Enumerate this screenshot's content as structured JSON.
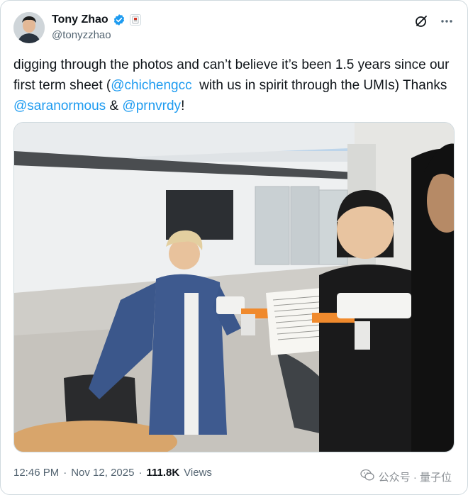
{
  "author": {
    "name": "Tony Zhao",
    "handle": "@tonyzzhao"
  },
  "post": {
    "text_segments": [
      {
        "text": "digging through the photos and can’t believe it’s been 1.5 years since our first term sheet (",
        "type": "text"
      },
      {
        "text": "@chichengcc",
        "type": "mention"
      },
      {
        "text": "  with us in spirit through the UMIs) Thanks ",
        "type": "text"
      },
      {
        "text": "@saranormous",
        "type": "mention"
      },
      {
        "text": " & ",
        "type": "text"
      },
      {
        "text": "@prnvrdy",
        "type": "mention"
      },
      {
        "text": "!",
        "type": "text"
      }
    ],
    "time": "12:46 PM",
    "date": "Nov 12, 2025",
    "separator": "·",
    "views_count": "111.8K",
    "views_label": "Views"
  },
  "watermark": {
    "text": "公众号 · 量子位"
  },
  "icons": {
    "verified": "verified-badge-icon",
    "affiliate": "affiliate-badge-icon",
    "grok": "grok-icon",
    "more": "more-icon",
    "wechat": "wechat-icon"
  },
  "colors": {
    "text": "#0f1419",
    "secondary": "#536471",
    "link": "#1d9bf0",
    "border": "#cfd9de"
  }
}
